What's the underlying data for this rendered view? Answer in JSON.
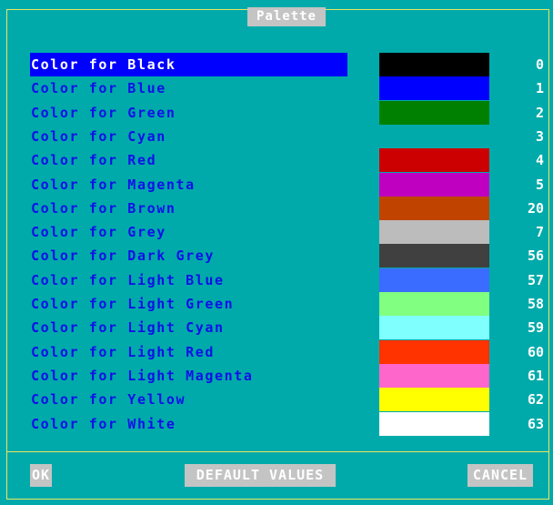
{
  "dialog": {
    "title": "Palette"
  },
  "rows": [
    {
      "label": "Color for Black",
      "swatch": "#000000",
      "value": "0",
      "selected": true
    },
    {
      "label": "Color for Blue",
      "swatch": "#0000ff",
      "value": "1"
    },
    {
      "label": "Color for Green",
      "swatch": "#008000",
      "value": "2"
    },
    {
      "label": "Color for Cyan",
      "swatch": "#00aaaa",
      "value": "3"
    },
    {
      "label": "Color for Red",
      "swatch": "#cc0000",
      "value": "4"
    },
    {
      "label": "Color for Magenta",
      "swatch": "#c000c0",
      "value": "5"
    },
    {
      "label": "Color for Brown",
      "swatch": "#c04400",
      "value": "20"
    },
    {
      "label": "Color for Grey",
      "swatch": "#bcbcbc",
      "value": "7"
    },
    {
      "label": "Color for Dark Grey",
      "swatch": "#404040",
      "value": "56"
    },
    {
      "label": "Color for Light Blue",
      "swatch": "#3a6cff",
      "value": "57"
    },
    {
      "label": "Color for Light Green",
      "swatch": "#80ff80",
      "value": "58"
    },
    {
      "label": "Color for Light Cyan",
      "swatch": "#80ffff",
      "value": "59"
    },
    {
      "label": "Color for Light Red",
      "swatch": "#ff3300",
      "value": "60"
    },
    {
      "label": "Color for Light Magenta",
      "swatch": "#ff66cc",
      "value": "61"
    },
    {
      "label": "Color for Yellow",
      "swatch": "#ffff00",
      "value": "62"
    },
    {
      "label": "Color for White",
      "swatch": "#ffffff",
      "value": "63"
    }
  ],
  "buttons": {
    "ok": "OK",
    "default": "DEFAULT VALUES",
    "cancel": "CANCEL"
  },
  "colors": {
    "background": "#00aaaa",
    "border": "#e8e860",
    "label_text": "#1010e8",
    "selection": "#0000ff",
    "button_bg": "#c4c4c4"
  }
}
